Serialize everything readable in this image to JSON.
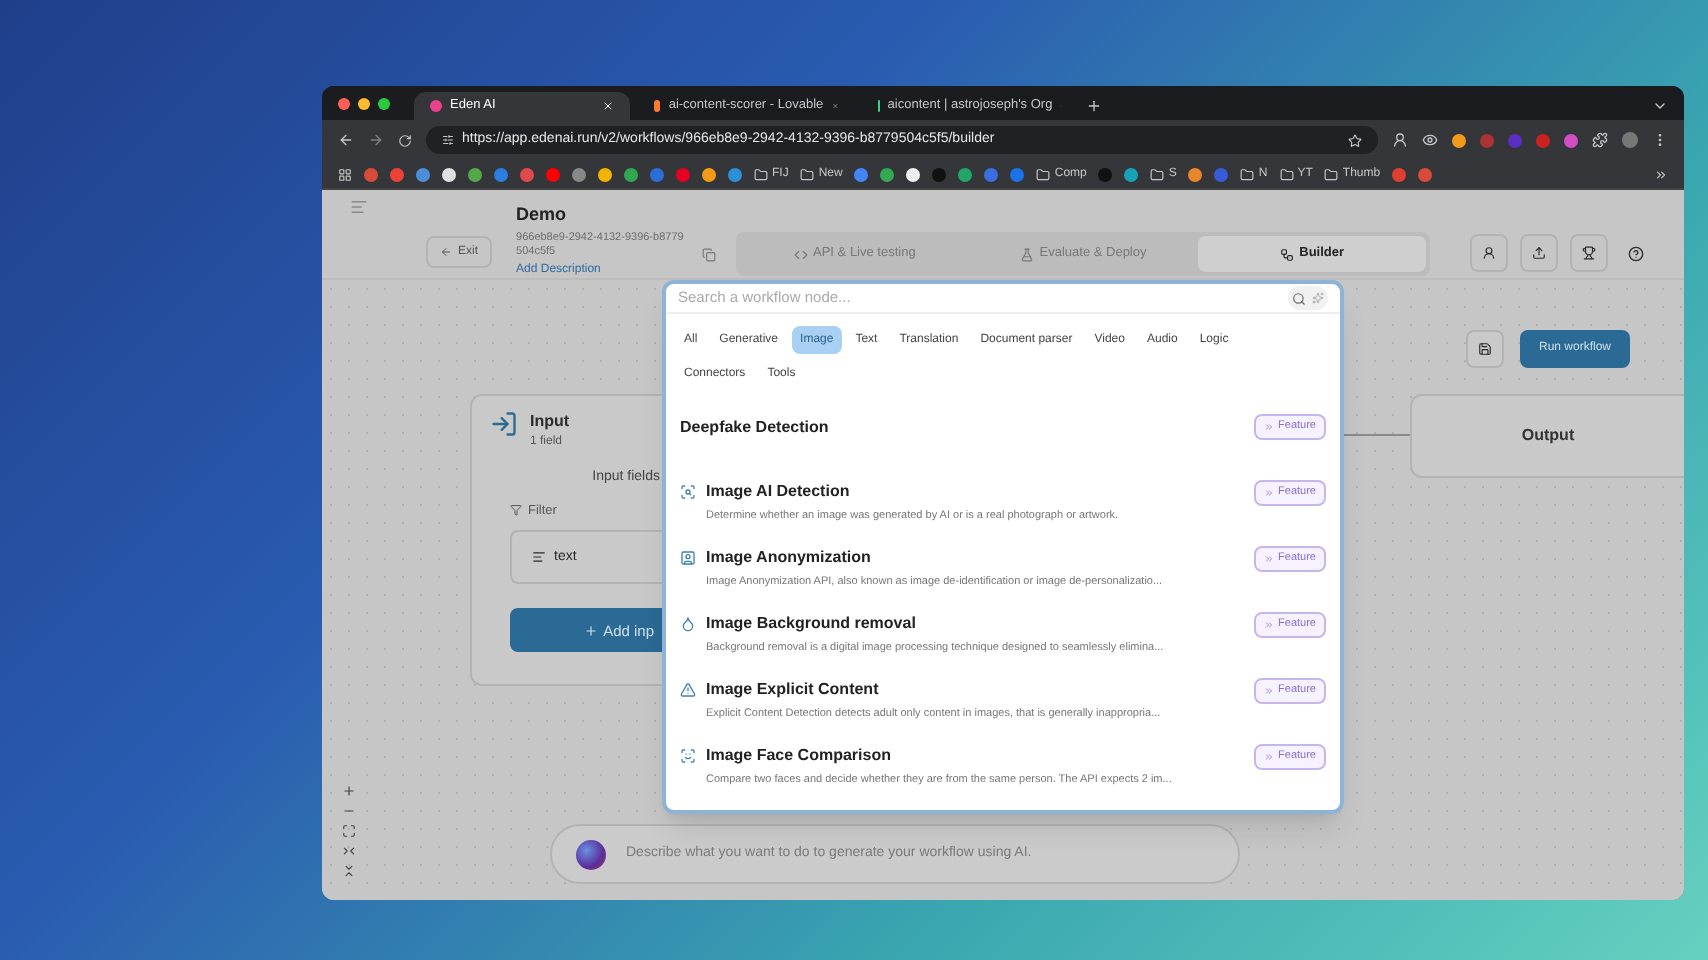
{
  "browser": {
    "tabs": [
      {
        "title": "Eden AI",
        "selected": true
      },
      {
        "title": "ai-content-scorer - Lovable",
        "selected": false
      },
      {
        "title": "aicontent | astrojoseph's Org",
        "selected": false
      }
    ],
    "url": "https://app.edenai.run/v2/workflows/966eb8e9-2942-4132-9396-b8779504c5f5/builder",
    "bookmarks": [
      {
        "kind": "site"
      },
      {
        "kind": "site"
      },
      {
        "kind": "site"
      },
      {
        "kind": "site"
      },
      {
        "kind": "site"
      },
      {
        "kind": "site"
      },
      {
        "kind": "site"
      },
      {
        "kind": "site"
      },
      {
        "kind": "site"
      },
      {
        "kind": "site"
      },
      {
        "kind": "site"
      },
      {
        "kind": "site"
      },
      {
        "kind": "site"
      },
      {
        "kind": "site"
      },
      {
        "kind": "site"
      },
      {
        "kind": "folder",
        "label": "FIJ"
      },
      {
        "kind": "folder",
        "label": "New"
      },
      {
        "kind": "site"
      },
      {
        "kind": "site"
      },
      {
        "kind": "site"
      },
      {
        "kind": "site"
      },
      {
        "kind": "site"
      },
      {
        "kind": "site"
      },
      {
        "kind": "site"
      },
      {
        "kind": "folder",
        "label": "Comp"
      },
      {
        "kind": "site"
      },
      {
        "kind": "site"
      },
      {
        "kind": "folder",
        "label": "S"
      },
      {
        "kind": "site"
      },
      {
        "kind": "site"
      },
      {
        "kind": "folder",
        "label": "N"
      },
      {
        "kind": "folder",
        "label": "YT"
      },
      {
        "kind": "folder",
        "label": "Thumb"
      },
      {
        "kind": "site"
      },
      {
        "kind": "site"
      }
    ]
  },
  "header": {
    "exit": "Exit",
    "title": "Demo",
    "workflow_id": "966eb8e9-2942-4132-9396-b8779504c5f5",
    "add_description": "Add Description",
    "tabs": [
      {
        "label": "API & Live testing",
        "selected": false
      },
      {
        "label": "Evaluate & Deploy",
        "selected": false
      },
      {
        "label": "Builder",
        "selected": true
      }
    ]
  },
  "toolbar": {
    "run": "Run workflow"
  },
  "canvas": {
    "input_node": {
      "title": "Input",
      "subtitle": "1 field",
      "section": "Input fields",
      "filter": "Filter",
      "field": "text",
      "add": "Add inp"
    },
    "output_node": {
      "title": "Output"
    }
  },
  "prompt": {
    "placeholder": "Describe what you want to do to generate your workflow using AI."
  },
  "modal": {
    "search": {
      "placeholder": "Search a workflow node..."
    },
    "categories": [
      {
        "label": "All",
        "selected": false
      },
      {
        "label": "Generative",
        "selected": false
      },
      {
        "label": "Image",
        "selected": true
      },
      {
        "label": "Text",
        "selected": false
      },
      {
        "label": "Translation",
        "selected": false
      },
      {
        "label": "Document parser",
        "selected": false
      },
      {
        "label": "Video",
        "selected": false
      },
      {
        "label": "Audio",
        "selected": false
      },
      {
        "label": "Logic",
        "selected": false
      },
      {
        "label": "Connectors",
        "selected": false
      },
      {
        "label": "Tools",
        "selected": false
      }
    ],
    "nodes": [
      {
        "kind": "group",
        "title": "Deepfake Detection",
        "badge": "Feature"
      },
      {
        "kind": "node",
        "title": "Image AI Detection",
        "description": "Determine whether an image was generated by AI or is a real photograph or artwork.",
        "badge": "Feature"
      },
      {
        "kind": "node",
        "title": "Image Anonymization",
        "description": "Image Anonymization API, also known as image de-identification or image de-personalizatio...",
        "badge": "Feature"
      },
      {
        "kind": "node",
        "title": "Image Background removal",
        "description": "Background removal is a digital image processing technique designed to seamlessly elimina...",
        "badge": "Feature"
      },
      {
        "kind": "node",
        "title": "Image Explicit Content",
        "description": "Explicit Content Detection detects adult only content in images, that is generally inappropria...",
        "badge": "Feature"
      },
      {
        "kind": "node",
        "title": "Image Face Comparison",
        "description": "Compare two faces and decide whether they are from the same person. The API expects 2 im...",
        "badge": "Feature"
      }
    ]
  }
}
